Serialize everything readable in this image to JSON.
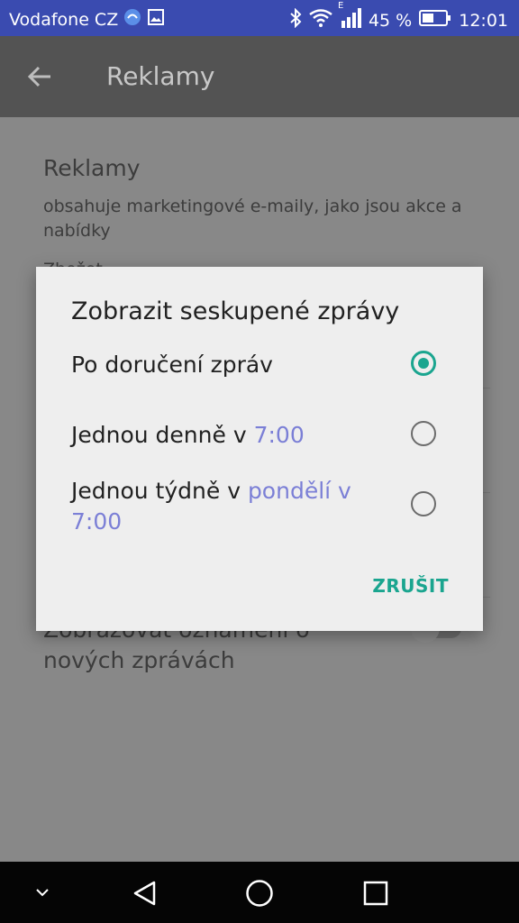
{
  "status_bar": {
    "carrier": "Vodafone CZ",
    "network_type": "E",
    "battery_percent": "45 %",
    "time": "12:01"
  },
  "app_bar": {
    "title": "Reklamy"
  },
  "settings": {
    "section_title": "Reklamy",
    "section_description": "obsahuje marketingové e-maily, jako jsou akce a nabídky",
    "partially_hidden_line": "Zbožet… ",
    "notification_label": "Zobrazovat oznámení o nových zprávách"
  },
  "dialog": {
    "title": "Zobrazit seskupené zprávy",
    "options": [
      {
        "text": "Po doručení zpráv",
        "accent": "",
        "selected": true
      },
      {
        "text": "Jednou denně v ",
        "accent": "7:00",
        "selected": false
      },
      {
        "text": "Jednou týdně v ",
        "accent": "pondělí v 7:00",
        "selected": false
      }
    ],
    "cancel_label": "ZRUŠIT"
  },
  "colors": {
    "status_bar": "#3a4bb0",
    "accent_teal": "#1aa58f",
    "accent_link": "#7b7fd6"
  }
}
